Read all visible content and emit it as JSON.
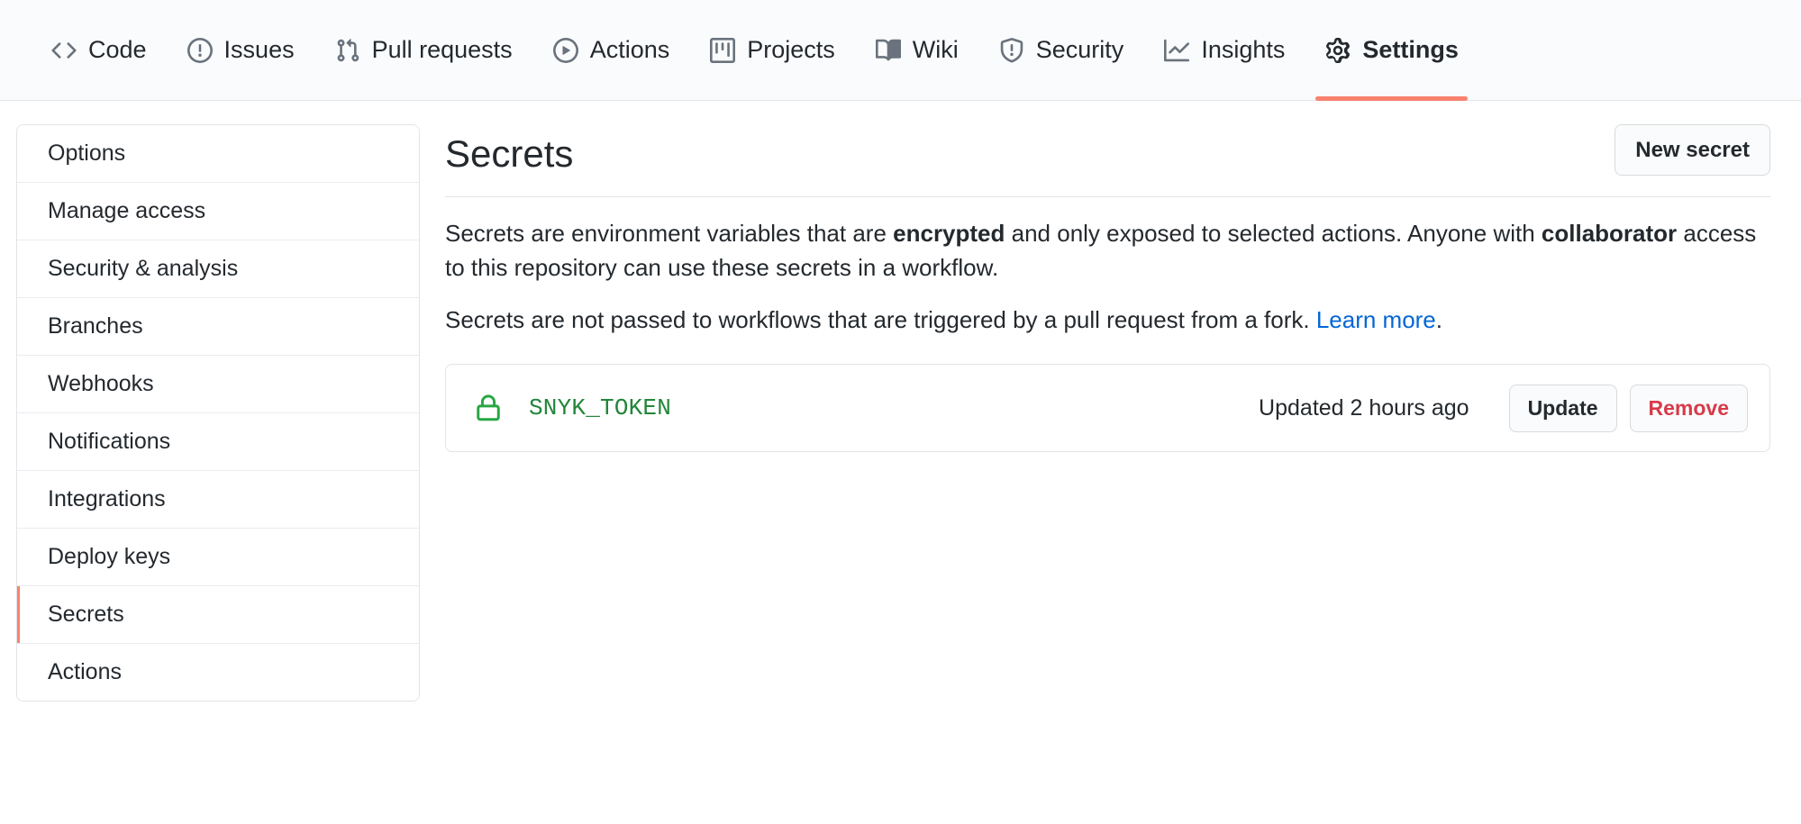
{
  "nav": {
    "items": [
      {
        "label": "Code",
        "icon": "code-icon",
        "selected": false
      },
      {
        "label": "Issues",
        "icon": "issue-opened-icon",
        "selected": false
      },
      {
        "label": "Pull requests",
        "icon": "git-pull-request-icon",
        "selected": false
      },
      {
        "label": "Actions",
        "icon": "play-icon",
        "selected": false
      },
      {
        "label": "Projects",
        "icon": "project-icon",
        "selected": false
      },
      {
        "label": "Wiki",
        "icon": "book-icon",
        "selected": false
      },
      {
        "label": "Security",
        "icon": "shield-icon",
        "selected": false
      },
      {
        "label": "Insights",
        "icon": "graph-icon",
        "selected": false
      },
      {
        "label": "Settings",
        "icon": "gear-icon",
        "selected": true
      }
    ]
  },
  "sidebar": {
    "items": [
      {
        "label": "Options",
        "selected": false
      },
      {
        "label": "Manage access",
        "selected": false
      },
      {
        "label": "Security & analysis",
        "selected": false
      },
      {
        "label": "Branches",
        "selected": false
      },
      {
        "label": "Webhooks",
        "selected": false
      },
      {
        "label": "Notifications",
        "selected": false
      },
      {
        "label": "Integrations",
        "selected": false
      },
      {
        "label": "Deploy keys",
        "selected": false
      },
      {
        "label": "Secrets",
        "selected": true
      },
      {
        "label": "Actions",
        "selected": false
      }
    ]
  },
  "main": {
    "title": "Secrets",
    "new_secret_label": "New secret",
    "description": {
      "p1_part1": "Secrets are environment variables that are ",
      "p1_bold1": "encrypted",
      "p1_part2": " and only exposed to selected actions. Anyone with ",
      "p1_bold2": "collaborator",
      "p1_part3": " access to this repository can use these secrets in a workflow.",
      "p2_part1": "Secrets are not passed to workflows that are triggered by a pull request from a fork. ",
      "p2_link": "Learn more",
      "p2_part2": "."
    },
    "secrets": [
      {
        "name": "SNYK_TOKEN",
        "icon": "lock-icon",
        "updated": "Updated 2 hours ago",
        "update_label": "Update",
        "remove_label": "Remove"
      }
    ]
  },
  "colors": {
    "accent_underline": "#f9826c",
    "secret_green": "#22863a",
    "link_blue": "#0366d6",
    "danger_red": "#d73a49",
    "border": "#e1e4e8",
    "nav_bg": "#fafbfc"
  }
}
